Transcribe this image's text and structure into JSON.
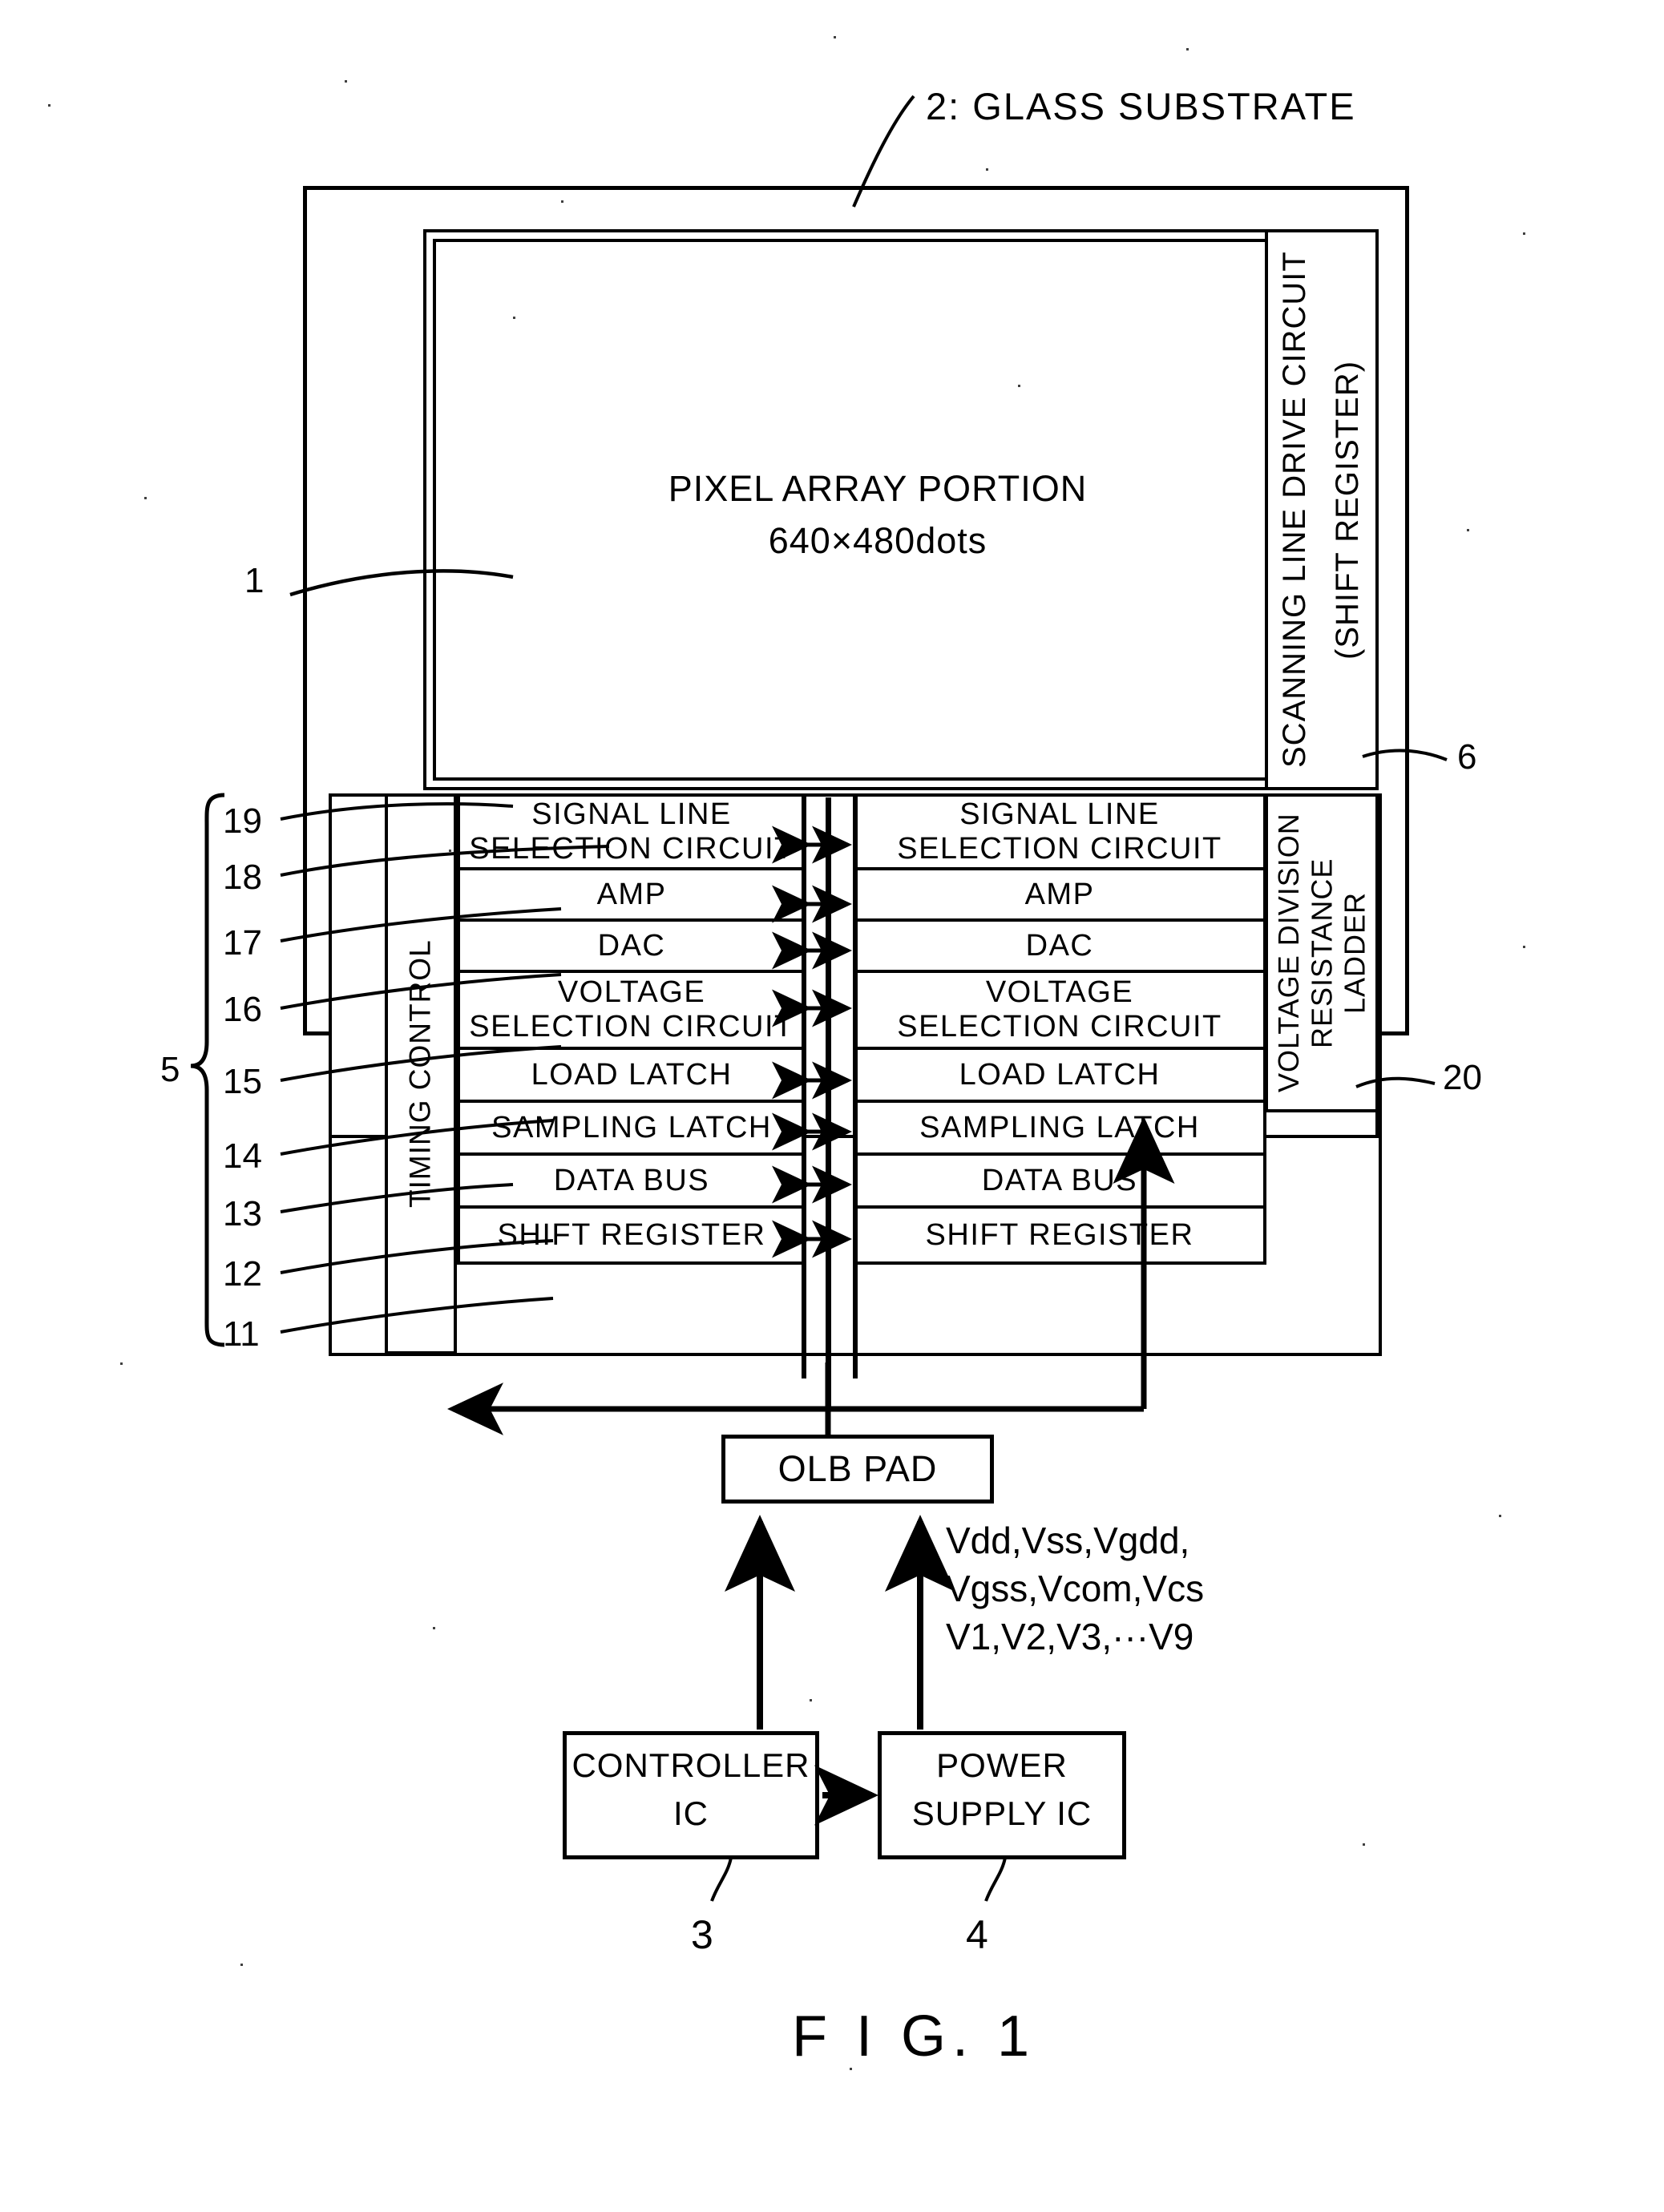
{
  "figure": {
    "label": "F I G. 1",
    "substrate_callout": "2:  GLASS SUBSTRATE"
  },
  "pixel_array": {
    "title": "PIXEL ARRAY PORTION",
    "resolution": "640×480dots",
    "ref": "1"
  },
  "scanning_line_drive": {
    "line1": "SCANNING LINE DRIVE CIRCUIT",
    "line2": "(SHIFT REGISTER)",
    "ref": "6"
  },
  "voltage_ladder": {
    "label": "VOLTAGE DIVISION RESISTANCE LADDER",
    "ref": "20"
  },
  "timing_control": {
    "label": "TIMING CONTROL",
    "ref": "19"
  },
  "driver_group": {
    "ref": "5",
    "rows": [
      {
        "ref": "18",
        "left": "SIGNAL LINE\nSELECTION CIRCUIT",
        "right": "SIGNAL LINE\nSELECTION CIRCUIT"
      },
      {
        "ref": "17",
        "left": "AMP",
        "right": "AMP"
      },
      {
        "ref": "16",
        "left": "DAC",
        "right": "DAC"
      },
      {
        "ref": "15",
        "left": "VOLTAGE\nSELECTION CIRCUIT",
        "right": "VOLTAGE\nSELECTION CIRCUIT"
      },
      {
        "ref": "14",
        "left": "LOAD LATCH",
        "right": "LOAD LATCH"
      },
      {
        "ref": "13",
        "left": "SAMPLING LATCH",
        "right": "SAMPLING LATCH"
      },
      {
        "ref": "12",
        "left": "DATA BUS",
        "right": "DATA BUS"
      },
      {
        "ref": "11",
        "left": "SHIFT REGISTER",
        "right": "SHIFT REGISTER"
      }
    ]
  },
  "olb_pad": {
    "label": "OLB PAD"
  },
  "power_rails": {
    "line1": "Vdd,Vss,Vgdd,",
    "line2": "Vgss,Vcom,Vcs",
    "line3": "V1,V2,V3,···V9"
  },
  "controller_ic": {
    "line1": "CONTROLLER",
    "line2": "IC",
    "ref": "3"
  },
  "power_supply_ic": {
    "line1": "POWER",
    "line2": "SUPPLY IC",
    "ref": "4"
  },
  "colors": {
    "ink": "#000000",
    "paper": "#ffffff"
  }
}
